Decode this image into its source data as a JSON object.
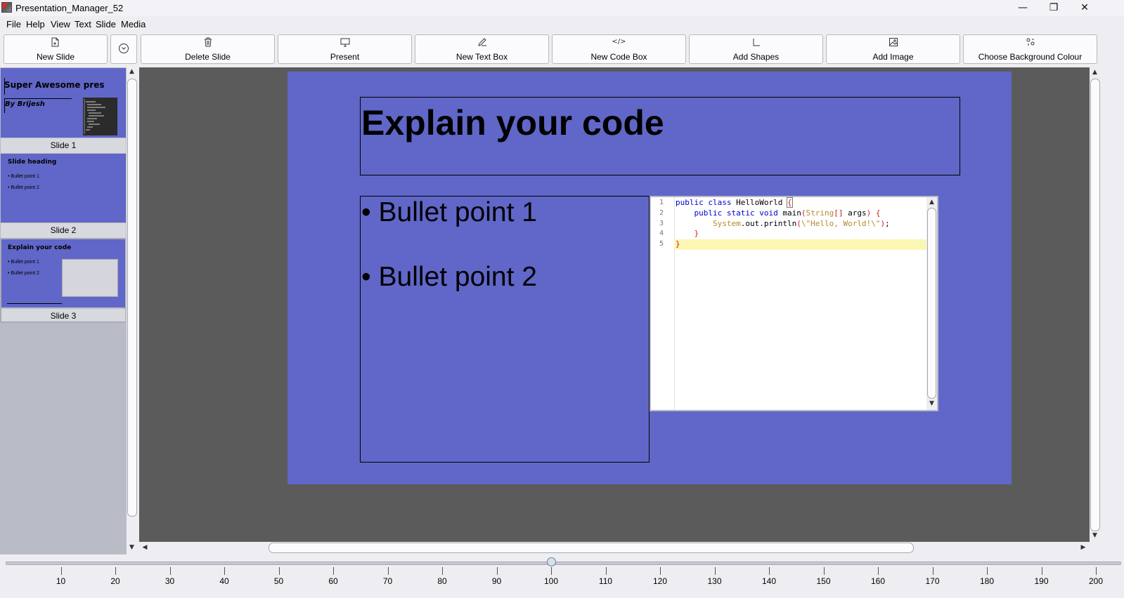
{
  "window": {
    "title": "Presentation_Manager_52",
    "minimize_glyph": "—",
    "restore_glyph": "❐",
    "close_glyph": "✕"
  },
  "menu": [
    "File",
    "Help",
    "View",
    "Text",
    "Slide",
    "Media"
  ],
  "toolbar": {
    "new_slide": {
      "label": "New Slide",
      "icon": "new-file-icon"
    },
    "dropdown": {
      "icon": "chevron-down-circle-icon",
      "glyph": "⌄"
    },
    "delete_slide": {
      "label": "Delete Slide",
      "icon": "trash-icon"
    },
    "present": {
      "label": "Present",
      "icon": "monitor-icon"
    },
    "new_text_box": {
      "label": "New Text Box",
      "icon": "pen-icon"
    },
    "new_code_box": {
      "label": "New Code Box",
      "icon": "code-icon",
      "glyph": "</>"
    },
    "add_shapes": {
      "label": "Add Shapes",
      "icon": "shapes-icon"
    },
    "add_image": {
      "label": "Add Image",
      "icon": "image-icon"
    },
    "choose_background": {
      "label": "Choose Background Colour",
      "icon": "palette-icon"
    }
  },
  "thumbnails": [
    {
      "label": "Slide 1",
      "title": "Super Awesome pres",
      "subtitle": "By Brijesh"
    },
    {
      "label": "Slide 2",
      "title": "Slide heading",
      "bullets": [
        "• Bullet point 1",
        "• Bullet point 2"
      ]
    },
    {
      "label": "Slide 3",
      "title": "Explain your code",
      "bullets": [
        "• Bullet point 1",
        "• Bullet point 2"
      ]
    }
  ],
  "slide": {
    "title": "Explain your code",
    "bullets": [
      "• Bullet point 1",
      "• Bullet point 2"
    ],
    "code": {
      "line_numbers": [
        "1",
        "2",
        "3",
        "4",
        "5"
      ],
      "current_line": 5
    }
  },
  "zoom": {
    "value": 100,
    "ticks": [
      "10",
      "20",
      "30",
      "40",
      "50",
      "60",
      "70",
      "80",
      "90",
      "100",
      "110",
      "120",
      "130",
      "140",
      "150",
      "160",
      "170",
      "180",
      "190",
      "200"
    ]
  },
  "colors": {
    "slide_background": "#6067c8",
    "canvas_background": "#5b5b5b",
    "code_keyword": "#0000cc",
    "code_string": "#b5892b",
    "code_bracket": "#cc2222",
    "current_line_highlight": "#fbf6b4"
  }
}
